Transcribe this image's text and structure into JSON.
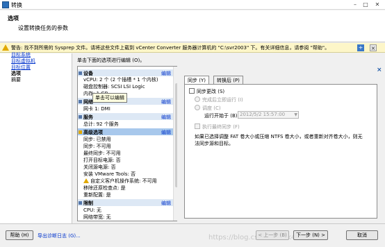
{
  "window": {
    "title": "转换"
  },
  "header": {
    "title": "选项",
    "subtitle": "设置转换任务的参数"
  },
  "warning": {
    "text": "警告: 找不到所需的 Sysprep 文件。请将这些文件上载到 vCenter Converter 服务器计算机的 \"C:\\svr2003\" 下。有关详细信息，请参阅 \"帮助\"。"
  },
  "nav": {
    "items": [
      {
        "label": "目标系统"
      },
      {
        "label": "目标虚拟机"
      },
      {
        "label": "目标位置"
      },
      {
        "label": "选项"
      },
      {
        "label": "摘要"
      }
    ]
  },
  "main": {
    "instruction": "单击下面的选项进行编辑 (O)。",
    "edit_label": "编辑",
    "tooltip": "单击可以编辑",
    "sections": [
      {
        "title": "设备",
        "lines": [
          "vCPU: 2 个 (2 个插槽 * 1 个内核)",
          "磁盘控制器: SCSI LSI Logic",
          "内存: 1 GB"
        ]
      },
      {
        "title": "网络",
        "lines": [
          "网卡 1: DMI"
        ]
      },
      {
        "title": "服务",
        "lines": [
          "总计: 92 个服务"
        ]
      },
      {
        "title": "高级选项",
        "lines": [
          "同步: 已禁用",
          "同步: 不可用",
          "最终同步: 不可用",
          "打开目标电源: 否",
          "关闭源电源: 否",
          "安装 VMware Tools: 否",
          "自定义客户机操作系统: 不可用",
          "移除还原检查点: 是",
          "重新配置: 是"
        ]
      },
      {
        "title": "限制",
        "lines": [
          "CPU: 无",
          "网络带宽: 无"
        ]
      }
    ]
  },
  "detail": {
    "tabs": [
      {
        "label": "同步 (Y)"
      },
      {
        "label": "转换后 (P)"
      }
    ],
    "sync_changes": "同步更改 (S)",
    "run_after": "完成后立即运行 (I)",
    "schedule": "调度 (C)",
    "run_at_label": "运行开始于 (B):",
    "run_at_value": "2012/5/2 15:57:00",
    "final_sync": "执行最终同步 (F)",
    "note": "如果已选择调整 FAT 卷大小或压缩 NTFS 卷大小，或者重新对齐卷大小，则无法同步源和目标。"
  },
  "footer": {
    "help": "帮助 (H)",
    "export_logs": "导出诊断日志 (G)...",
    "back": "< 上一步 (B)",
    "next": "下一步 (N) >",
    "cancel": "取消",
    "watermark": "https://blog.csdn.net/ak416046"
  }
}
